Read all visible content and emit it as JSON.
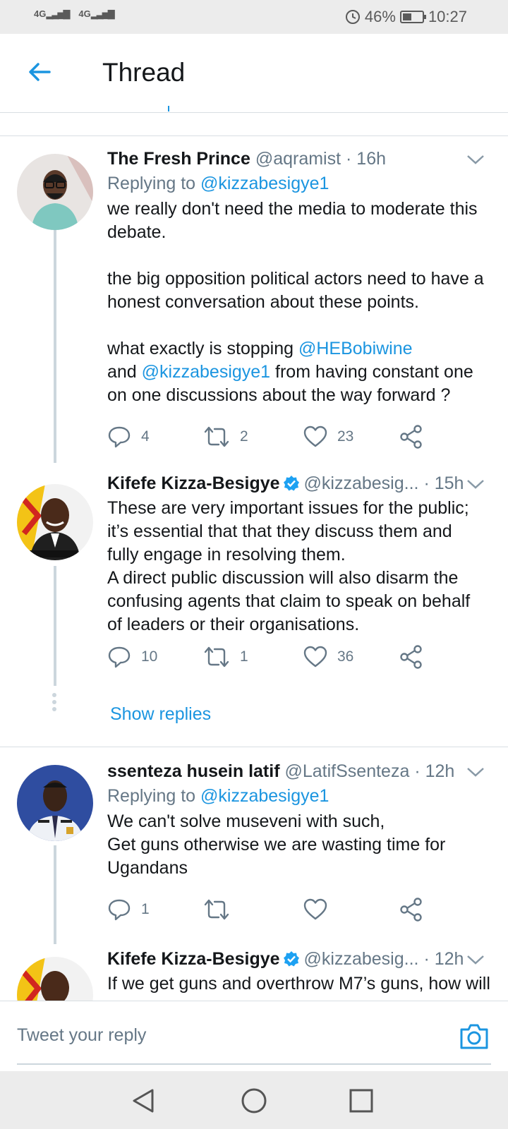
{
  "status_bar": {
    "signal_1": "4G",
    "signal_2": "4G",
    "battery_percent": "46%",
    "battery_level": 0.46,
    "time": "10:27"
  },
  "header": {
    "title": "Thread",
    "back_icon": "arrow-left-icon"
  },
  "tweets": [
    {
      "name": "The Fresh Prince",
      "handle": "@aqramist",
      "time": "· 16h",
      "verified": false,
      "replying_label": "Replying to ",
      "replying_to": "@kizzabesigye1",
      "text_1": "we really don't need the media to moderate this debate.\n\nthe big opposition political actors need to have a honest conversation about these points.\n\nwhat exactly is stopping ",
      "mention_1": "@HEBobiwine",
      "text_2": "\nand ",
      "mention_2": "@kizzabesigye1",
      "text_3": " from having constant one on one discussions about the way forward ?",
      "replies": "4",
      "retweets": "2",
      "likes": "23"
    },
    {
      "name": "Kifefe Kizza-Besigye",
      "handle": "@kizzabesig...",
      "time": "· 15h",
      "verified": true,
      "text": "These are very important issues for the public; it’s essential that that they discuss them and fully engage in resolving them.\nA direct public discussion will also disarm the confusing agents that claim to speak on behalf of leaders or their organisations.",
      "replies": "10",
      "retweets": "1",
      "likes": "36",
      "show_replies": "Show replies"
    },
    {
      "name": "ssenteza husein latif",
      "handle": "@LatifSsenteza",
      "time": "· 12h",
      "verified": false,
      "replying_label": "Replying to ",
      "replying_to": "@kizzabesigye1",
      "text": "We can't solve museveni with such,\nGet guns otherwise we are wasting time for Ugandans",
      "replies": "1",
      "retweets": "",
      "likes": ""
    },
    {
      "name": "Kifefe Kizza-Besigye",
      "handle": "@kizzabesig...",
      "time": "· 12h",
      "verified": true,
      "text": "If we get guns and overthrow M7’s guns, how will"
    }
  ],
  "reply_bar": {
    "placeholder": "Tweet your reply",
    "camera_icon": "camera-icon"
  },
  "colors": {
    "accent": "#1b95e0",
    "text_secondary": "#657786",
    "divider": "#d8dee3",
    "thread_line": "#ccd6dd"
  }
}
